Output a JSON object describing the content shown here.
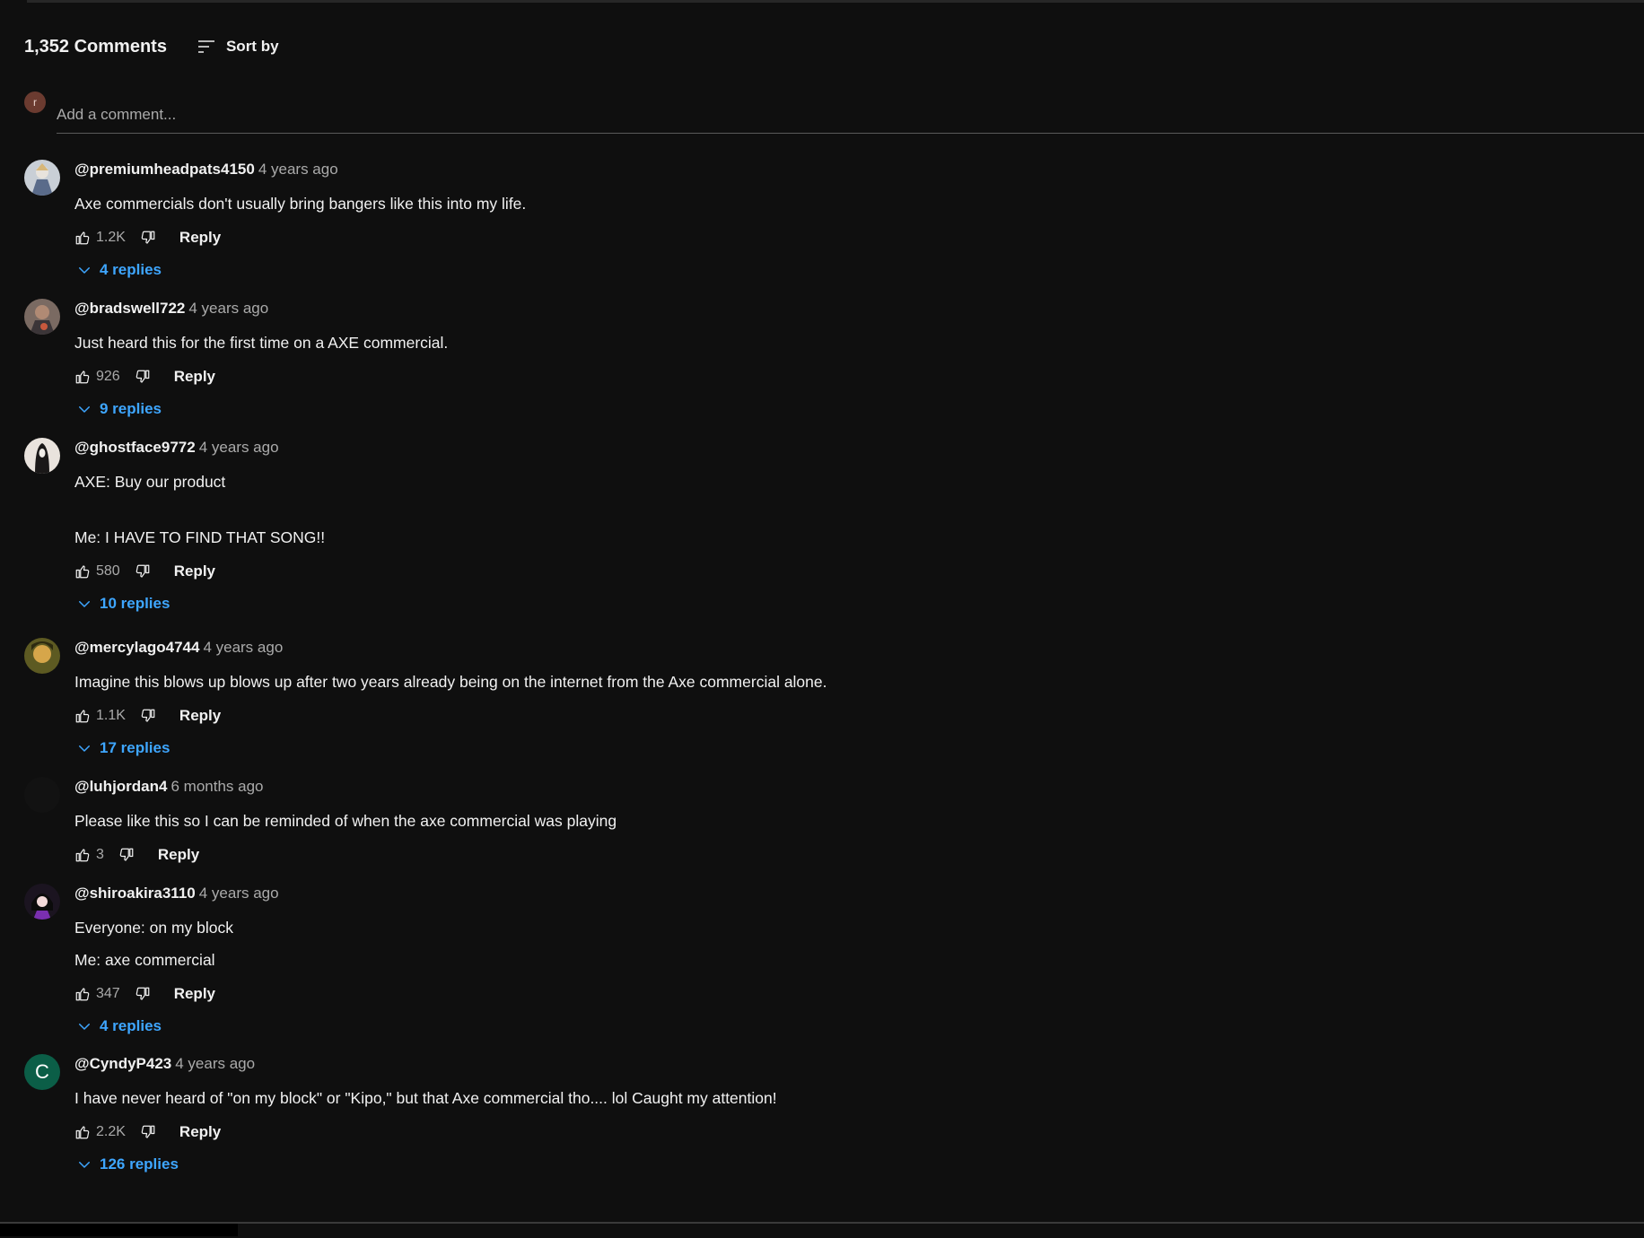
{
  "header": {
    "count": "1,352 Comments",
    "sort_label": "Sort by"
  },
  "add_comment": {
    "avatar_letter": "r",
    "placeholder": "Add a comment..."
  },
  "comments": [
    {
      "author": "@premiumheadpats4150",
      "time": "4 years ago",
      "lines": [
        "Axe commercials don't usually bring bangers like this into my life."
      ],
      "likes": "1.2K",
      "reply": "Reply",
      "replies": "4 replies"
    },
    {
      "author": "@bradswell722",
      "time": "4 years ago",
      "lines": [
        "Just heard this for the first time on a AXE commercial."
      ],
      "likes": "926",
      "reply": "Reply",
      "replies": "9 replies"
    },
    {
      "author": "@ghostface9772",
      "time": "4 years ago",
      "lines": [
        "AXE: Buy our product",
        "Me: I HAVE TO FIND THAT SONG!!"
      ],
      "likes": "580",
      "reply": "Reply",
      "replies": "10 replies"
    },
    {
      "author": "@mercylago4744",
      "time": "4 years ago",
      "lines": [
        "Imagine this blows up blows up after two years already being on the internet from the Axe commercial alone."
      ],
      "likes": "1.1K",
      "reply": "Reply",
      "replies": "17 replies"
    },
    {
      "author": "@luhjordan4",
      "time": "6 months ago",
      "lines": [
        "Please like this so I can be reminded of when the axe commercial was playing"
      ],
      "likes": "3",
      "reply": "Reply",
      "replies": ""
    },
    {
      "author": "@shiroakira3110",
      "time": "4 years ago",
      "lines": [
        "Everyone: on my block",
        "Me: axe commercial"
      ],
      "likes": "347",
      "reply": "Reply",
      "replies": "4 replies"
    },
    {
      "author": "@CyndyP423",
      "time": "4 years ago",
      "lines": [
        "I have never heard of \"on my block\" or \"Kipo,\" but that Axe commercial tho.... lol Caught my attention!"
      ],
      "likes": "2.2K",
      "reply": "Reply",
      "replies": "126 replies",
      "avatar_letter": "C"
    }
  ],
  "colors": {
    "background": "#0f0f0f",
    "text": "#f1f1f1",
    "secondary": "#aaaaaa",
    "link": "#3ea6ff"
  },
  "icons": [
    "sort-icon",
    "thumbs-up-icon",
    "thumbs-down-icon",
    "chevron-down-icon"
  ]
}
